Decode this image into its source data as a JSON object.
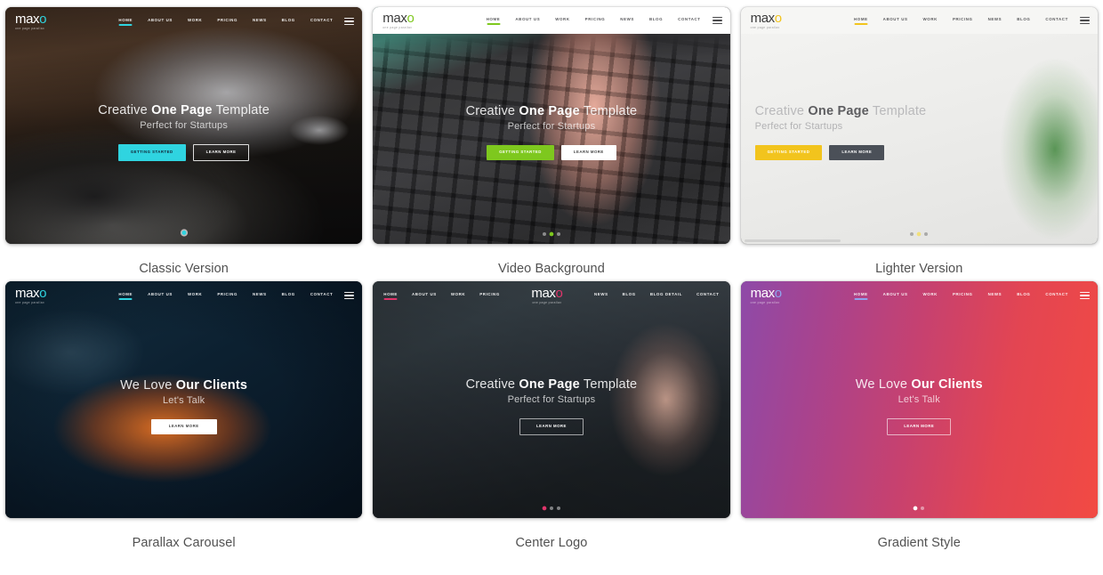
{
  "brand": {
    "word_main": "max",
    "word_accent": "o",
    "tagline": "one page parallax"
  },
  "nav": {
    "items": [
      "HOME",
      "ABOUT US",
      "WORK",
      "PRICING",
      "NEWS",
      "BLOG",
      "CONTACT"
    ],
    "center_left": [
      "HOME",
      "ABOUT US",
      "WORK",
      "PRICING"
    ],
    "center_right": [
      "NEWS",
      "BLOG",
      "BLOG DETAIL",
      "CONTACT"
    ],
    "menu_icon": "hamburger-menu-icon"
  },
  "hero_copy": {
    "title_a": "Creative ",
    "title_b": "One Page",
    "title_c": " Template",
    "subtitle": "Perfect for Startups",
    "clients_a": "We Love ",
    "clients_b": "Our Clients",
    "clients_sub": "Let's Talk",
    "btn_start": "GETTING STARTED",
    "btn_learn": "LEARN MORE"
  },
  "cards": [
    {
      "id": "classic-version",
      "caption": "Classic Version",
      "accent": "#2fd4e0",
      "nav_style": "overlay-dark",
      "hero": "template",
      "buttons": [
        "GETTING STARTED",
        "LEARN MORE"
      ],
      "indicator": "single-dot"
    },
    {
      "id": "video-background",
      "caption": "Video Background",
      "accent": "#7ec81e",
      "nav_style": "white-bar",
      "hero": "template",
      "buttons": [
        "GETTING STARTED",
        "LEARN MORE"
      ],
      "indicator": "dots-3",
      "active_dot": 1
    },
    {
      "id": "lighter-version",
      "caption": "Lighter Version",
      "accent": "#f2c41d",
      "nav_style": "white-bar",
      "hero": "template-left",
      "buttons": [
        "GETTING STARTED",
        "LEARN MORE"
      ],
      "indicator": "dots-3",
      "active_dot": 1
    },
    {
      "id": "parallax-carousel",
      "caption": "Parallax Carousel",
      "accent": "#2fd4e0",
      "nav_style": "overlay-dark",
      "hero": "clients",
      "buttons": [
        "LEARN MORE"
      ],
      "indicator": "none"
    },
    {
      "id": "center-logo",
      "caption": "Center Logo",
      "accent": "#e0356b",
      "nav_style": "overlay-center",
      "hero": "template",
      "buttons": [
        "LEARN MORE"
      ],
      "indicator": "dots-3",
      "active_dot": 0
    },
    {
      "id": "gradient-style",
      "caption": "Gradient Style",
      "accent": "#7b8fe0",
      "nav_style": "overlay-dark",
      "hero": "clients",
      "buttons": [
        "LEARN MORE"
      ],
      "indicator": "dots-2",
      "active_dot": 0
    }
  ]
}
